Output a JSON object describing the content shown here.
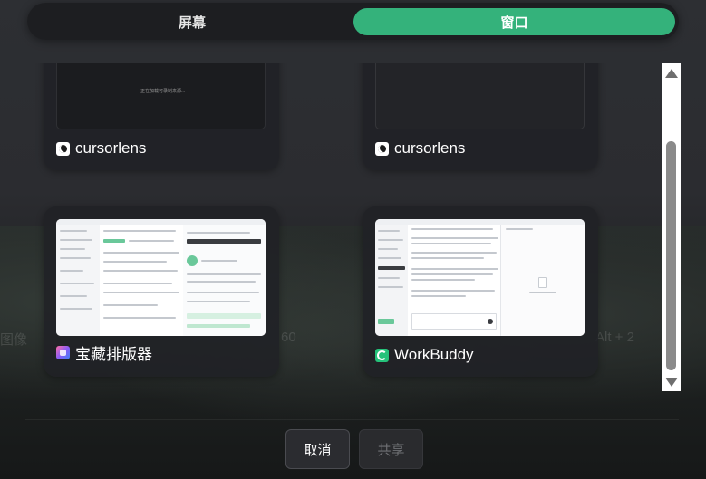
{
  "tabs": {
    "screen_label": "屏幕",
    "window_label": "窗口",
    "active": "window"
  },
  "windows": [
    {
      "name": "cursorlens",
      "icon": "cursorlens-app-icon",
      "preview_text": "正在加载可录制来源..."
    },
    {
      "name": "cursorlens",
      "icon": "cursorlens-app-icon"
    },
    {
      "name": "宝藏排版器",
      "icon": "treasure-typesetter-app-icon"
    },
    {
      "name": "WorkBuddy",
      "icon": "workbuddy-app-icon"
    }
  ],
  "background_hints": {
    "left": "图像",
    "mid": "60",
    "right": "Alt + 2"
  },
  "buttons": {
    "cancel_label": "取消",
    "share_label": "共享",
    "share_enabled": false
  },
  "colors": {
    "accent": "#34b27b",
    "panel": "#202125"
  }
}
